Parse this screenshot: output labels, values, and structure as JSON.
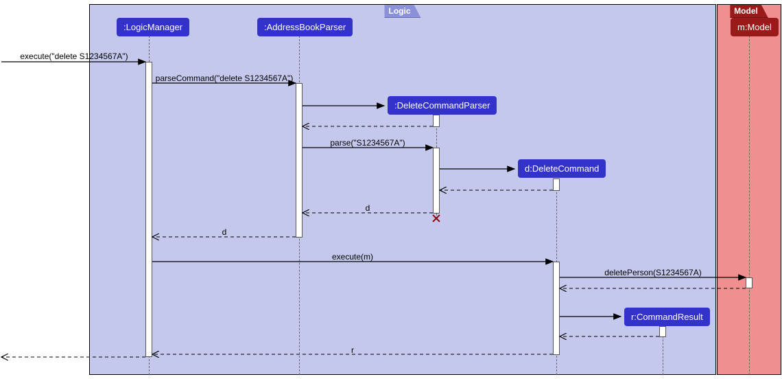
{
  "diagram": {
    "type": "sequence",
    "frames": {
      "logic": {
        "name": "Logic"
      },
      "model": {
        "name": "Model"
      }
    },
    "participants": {
      "logicManager": {
        "label": ":LogicManager"
      },
      "addressBookParser": {
        "label": ":AddressBookParser"
      },
      "deleteCommandParser": {
        "label": ":DeleteCommandParser"
      },
      "deleteCommand": {
        "label": "d:DeleteCommand"
      },
      "commandResult": {
        "label": "r:CommandResult"
      },
      "model": {
        "label": "m:Model"
      }
    },
    "messages": {
      "m1": "execute(\"delete S1234567A\")",
      "m2": "parseCommand(\"delete S1234567A\")",
      "m3_return_dcp": "",
      "m4": "parse(\"S1234567A\")",
      "m5_return_dc": "",
      "m6": "d",
      "m7": "d",
      "m8": "execute(m)",
      "m9": "deletePerson(S1234567A)",
      "m10_return_model": "",
      "m11_return_cr": "",
      "m12": "r",
      "m13_return_out": ""
    }
  }
}
